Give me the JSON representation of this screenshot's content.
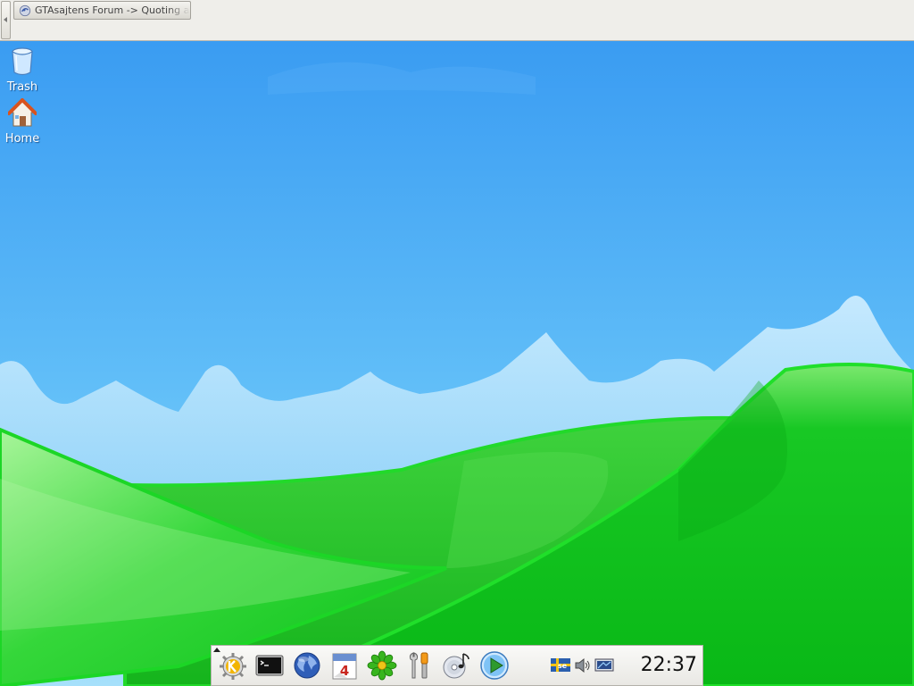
{
  "topbar": {
    "task_title": "GTAsajtens Forum -> Quoting a Post - Konqueror"
  },
  "desktop": {
    "icons": [
      {
        "label": "Trash",
        "icon": "trash-icon"
      },
      {
        "label": "Home",
        "icon": "home-icon"
      }
    ]
  },
  "panel": {
    "launchers": [
      {
        "icon": "kde-menu-icon"
      },
      {
        "icon": "terminal-icon"
      },
      {
        "icon": "web-browser-icon"
      },
      {
        "icon": "calendar-icon"
      },
      {
        "icon": "icq-icon"
      },
      {
        "icon": "settings-tools-icon"
      },
      {
        "icon": "cd-music-icon"
      },
      {
        "icon": "media-player-icon"
      }
    ],
    "tray": [
      {
        "icon": "keyboard-layout-icon",
        "text": "se"
      },
      {
        "icon": "volume-icon"
      },
      {
        "icon": "network-icon"
      }
    ],
    "clock": "22:37"
  },
  "colors": {
    "sky_top": "#3b9df2",
    "sky_bottom": "#8fd6fb",
    "grass": "#0ec51a",
    "grass_light": "#7ef07a"
  }
}
